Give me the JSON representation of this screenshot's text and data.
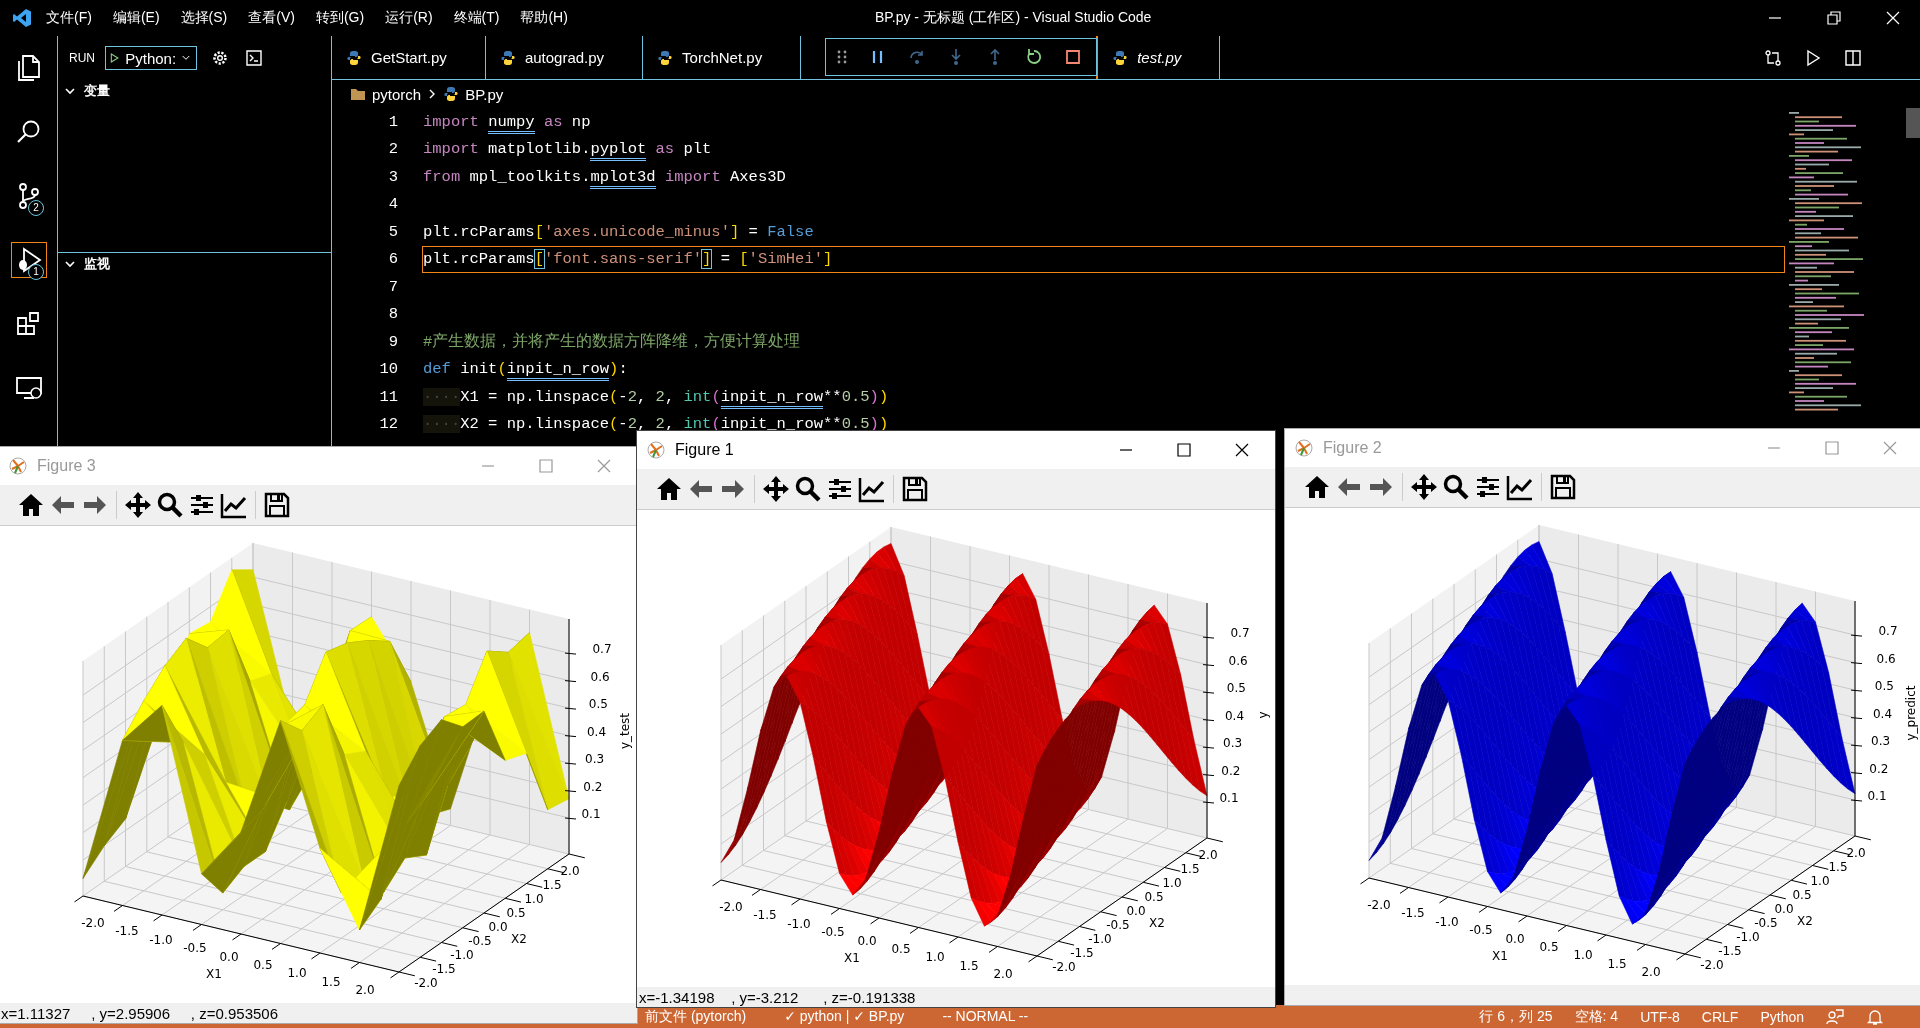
{
  "window": {
    "title": "BP.py - 无标题 (工作区) - Visual Studio Code"
  },
  "menu": [
    "文件(F)",
    "编辑(E)",
    "选择(S)",
    "查看(V)",
    "转到(G)",
    "运行(R)",
    "终端(T)",
    "帮助(H)"
  ],
  "activity_bar": [
    {
      "kind": "files",
      "selected": false
    },
    {
      "kind": "search",
      "selected": false
    },
    {
      "kind": "source-control",
      "selected": false,
      "badge": "2"
    },
    {
      "kind": "debug",
      "selected": true,
      "badge": "1"
    },
    {
      "kind": "extensions",
      "selected": false
    },
    {
      "kind": "remote",
      "selected": false
    }
  ],
  "run_panel": {
    "label": "RUN",
    "config": "Python:",
    "sections": [
      {
        "title": "变量",
        "expanded": true
      },
      {
        "title": "监视",
        "expanded": true
      }
    ]
  },
  "tabs": [
    {
      "label": "GetStart.py",
      "preview": false
    },
    {
      "label": "autograd.py",
      "preview": false
    },
    {
      "label": "TorchNet.py",
      "preview": false
    },
    {
      "label": "test.py",
      "preview": true
    }
  ],
  "debug_toolbar": [
    {
      "kind": "grip",
      "disabled": false
    },
    {
      "kind": "pause",
      "disabled": false
    },
    {
      "kind": "step-over",
      "disabled": true
    },
    {
      "kind": "step-into",
      "disabled": true
    },
    {
      "kind": "step-out",
      "disabled": true
    },
    {
      "kind": "restart",
      "disabled": false
    },
    {
      "kind": "stop",
      "disabled": false
    }
  ],
  "breadcrumb": [
    "pytorch",
    "BP.py"
  ],
  "code": {
    "lines": [
      {
        "number": "1",
        "current": false,
        "tokens": [
          {
            "text": "import ",
            "kind": "kw"
          },
          {
            "text": "numpy",
            "kind": "id",
            "underline": true
          },
          {
            "text": " as",
            "kind": "kw"
          },
          {
            "text": " np",
            "kind": "id"
          }
        ]
      },
      {
        "number": "2",
        "current": false,
        "tokens": [
          {
            "text": "import",
            "kind": "kw"
          },
          {
            "text": " matplotlib.",
            "kind": "id"
          },
          {
            "text": "pyplot",
            "kind": "id",
            "underline": true
          },
          {
            "text": " as",
            "kind": "kw"
          },
          {
            "text": " plt",
            "kind": "id"
          }
        ]
      },
      {
        "number": "3",
        "current": false,
        "tokens": [
          {
            "text": "from",
            "kind": "kw"
          },
          {
            "text": " mpl_toolkits.",
            "kind": "id"
          },
          {
            "text": "mplot3d",
            "kind": "id",
            "underline": true
          },
          {
            "text": " import",
            "kind": "kw"
          },
          {
            "text": " Axes3D",
            "kind": "id"
          }
        ]
      },
      {
        "number": "4",
        "current": false
      },
      {
        "number": "5",
        "current": false,
        "tokens": [
          {
            "text": "plt.rcParams",
            "kind": "id"
          },
          {
            "text": "[",
            "kind": "br1"
          },
          {
            "text": "'axes.unicode_minus'",
            "kind": "str"
          },
          {
            "text": "]",
            "kind": "br1"
          },
          {
            "text": " = ",
            "kind": "id"
          },
          {
            "text": "False",
            "kind": "const"
          }
        ]
      },
      {
        "number": "6",
        "current": true,
        "tokens": [
          {
            "text": "plt.rcParams",
            "kind": "id"
          },
          {
            "text": "[",
            "kind": "br1",
            "boxed": true
          },
          {
            "text": "'font.sans-serif'",
            "kind": "str"
          },
          {
            "text": "]",
            "kind": "br1",
            "boxed": true
          },
          {
            "text": " = ",
            "kind": "id"
          },
          {
            "text": "[",
            "kind": "br1"
          },
          {
            "text": "'SimHei'",
            "kind": "str"
          },
          {
            "text": "]",
            "kind": "br1"
          }
        ]
      },
      {
        "number": "7",
        "current": false
      },
      {
        "number": "8",
        "current": false
      },
      {
        "number": "9",
        "current": false,
        "tokens": [
          {
            "text": "#产生数据，并将产生的数据方阵降维，方便计算处理",
            "kind": "cmt"
          }
        ]
      },
      {
        "number": "10",
        "current": false,
        "tokens": [
          {
            "text": "def",
            "kind": "const"
          },
          {
            "text": " init",
            "kind": "id"
          },
          {
            "text": "(",
            "kind": "br1"
          },
          {
            "text": "inpit_n_row",
            "kind": "id",
            "underline": true
          },
          {
            "text": ")",
            "kind": "br1"
          },
          {
            "text": ":",
            "kind": "id"
          }
        ]
      },
      {
        "number": "11",
        "current": false,
        "tokens": [
          {
            "text": "····",
            "kind": "ws"
          },
          {
            "text": "X1 = np.linspace",
            "kind": "id"
          },
          {
            "text": "(",
            "kind": "br1"
          },
          {
            "text": "-",
            "kind": "id"
          },
          {
            "text": "2",
            "kind": "num"
          },
          {
            "text": ", ",
            "kind": "id"
          },
          {
            "text": "2",
            "kind": "num"
          },
          {
            "text": ", ",
            "kind": "id"
          },
          {
            "text": "int",
            "kind": "builtin"
          },
          {
            "text": "(",
            "kind": "br2"
          },
          {
            "text": "inpit_n_row",
            "kind": "id",
            "underline": true
          },
          {
            "text": "**",
            "kind": "id"
          },
          {
            "text": "0.5",
            "kind": "num"
          },
          {
            "text": ")",
            "kind": "br2"
          },
          {
            "text": ")",
            "kind": "br1"
          }
        ]
      },
      {
        "number": "12",
        "current": false,
        "tokens": [
          {
            "text": "····",
            "kind": "ws"
          },
          {
            "text": "X2 = np.linspace",
            "kind": "id"
          },
          {
            "text": "(",
            "kind": "br1"
          },
          {
            "text": "-",
            "kind": "id"
          },
          {
            "text": "2",
            "kind": "num"
          },
          {
            "text": ", ",
            "kind": "id"
          },
          {
            "text": "2",
            "kind": "num"
          },
          {
            "text": ", ",
            "kind": "id"
          },
          {
            "text": "int",
            "kind": "builtin"
          },
          {
            "text": "(",
            "kind": "br2"
          },
          {
            "text": "inpit_n_row",
            "kind": "id",
            "underline": true
          },
          {
            "text": "**",
            "kind": "id"
          },
          {
            "text": "0.5",
            "kind": "num"
          },
          {
            "text": ")",
            "kind": "br2"
          },
          {
            "text": ")",
            "kind": "br1"
          }
        ]
      }
    ]
  },
  "figures": [
    {
      "title": "Figure 3",
      "active": false,
      "kind": "trisurf",
      "color": "#ffff00",
      "xlabel": "X1",
      "ylabel": "X2",
      "zlabel": "y_test",
      "xticks": [
        "-2.0",
        "-1.5",
        "-1.0",
        "-0.5",
        "0.0",
        "0.5",
        "1.0",
        "1.5",
        "2.0"
      ],
      "yticks": [
        "-2.0",
        "-1.5",
        "-1.0",
        "-0.5",
        "0.0",
        "0.5",
        "1.0",
        "1.5",
        "2.0"
      ],
      "zticks": [
        "0.7",
        "0.6",
        "0.5",
        "0.4",
        "0.3",
        "0.2",
        "0.1"
      ],
      "coords": "x=1.11327     , y=2.95906     , z=0.953506"
    },
    {
      "title": "Figure 1",
      "active": true,
      "kind": "surface",
      "color": "#ff0000",
      "xlabel": "X1",
      "ylabel": "X2",
      "zlabel": "y",
      "xticks": [
        "-2.0",
        "-1.5",
        "-1.0",
        "-0.5",
        "0.0",
        "0.5",
        "1.0",
        "1.5",
        "2.0"
      ],
      "yticks": [
        "-2.0",
        "-1.5",
        "-1.0",
        "-0.5",
        "0.0",
        "0.5",
        "1.0",
        "1.5",
        "2.0"
      ],
      "zticks": [
        "0.7",
        "0.6",
        "0.5",
        "0.4",
        "0.3",
        "0.2",
        "0.1"
      ],
      "coords": "x=-1.34198    , y=-3.212      , z=-0.191338"
    },
    {
      "title": "Figure 2",
      "active": false,
      "kind": "surface",
      "color": "#0000ff",
      "xlabel": "X1",
      "ylabel": "X2",
      "zlabel": "y_predict",
      "xticks": [
        "-2.0",
        "-1.5",
        "-1.0",
        "-0.5",
        "0.0",
        "0.5",
        "1.0",
        "1.5",
        "2.0"
      ],
      "yticks": [
        "-2.0",
        "-1.5",
        "-1.0",
        "-0.5",
        "0.0",
        "0.5",
        "1.0",
        "1.5",
        "2.0"
      ],
      "zticks": [
        "0.7",
        "0.6",
        "0.5",
        "0.4",
        "0.3",
        "0.2",
        "0.1"
      ]
    }
  ],
  "status_bar": {
    "left": [
      "前文件 (pytorch)",
      "✓ python | ✓ BP.py",
      "-- NORMAL --"
    ],
    "right": [
      "行 6，列 25",
      "空格: 4",
      "UTF-8",
      "CRLF",
      "Python"
    ]
  }
}
